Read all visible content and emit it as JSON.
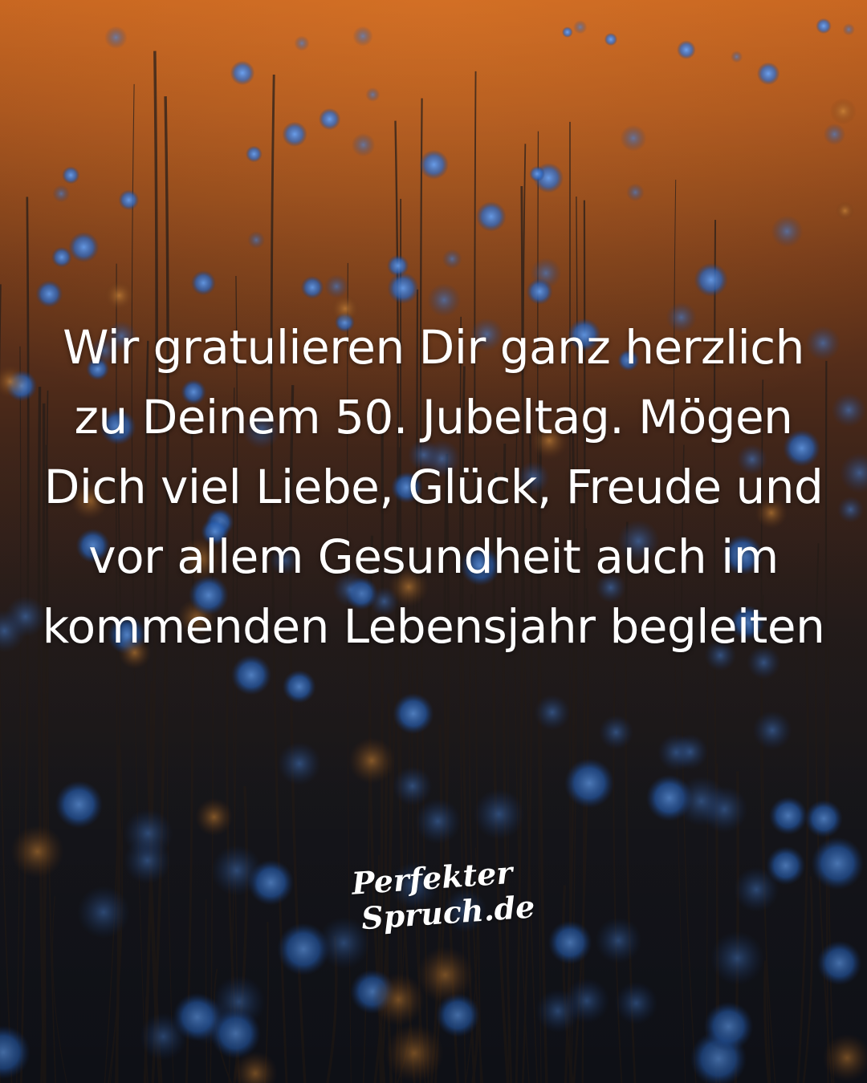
{
  "scene": {
    "description_colors": {
      "sky_top": "#c2621f",
      "sky_mid": "#7a3e1c",
      "ground": "#151822",
      "flower_blue": "#3a7fd6",
      "stem": "#2a2420"
    }
  },
  "quote": {
    "lines": [
      "Wir gratulieren Dir ganz herzlich",
      "zu Deinem 50. Jubeltag. Mögen",
      "Dich viel Liebe, Glück, Freude und",
      "vor allem Gesundheit auch im",
      "kommenden Lebensjahr begleiten"
    ]
  },
  "logo": {
    "line1": "Perfekter",
    "line2": "Spruch.de"
  }
}
